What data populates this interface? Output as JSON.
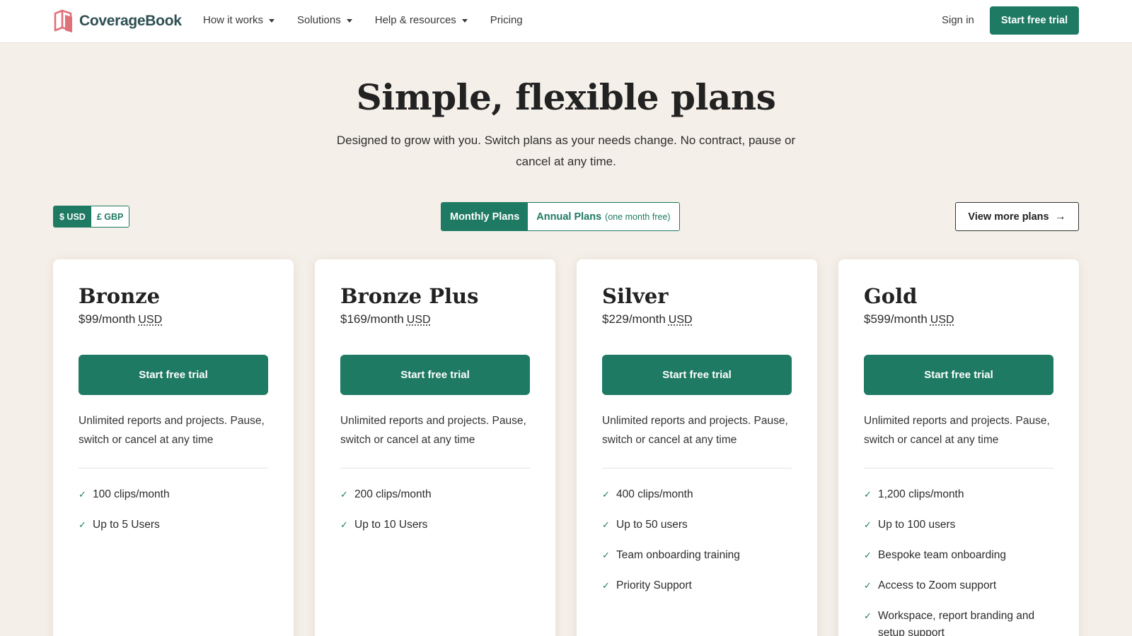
{
  "nav": {
    "logo_text": "CoverageBook",
    "links": [
      "How it works",
      "Solutions",
      "Help & resources",
      "Pricing"
    ],
    "sign_in": "Sign in",
    "cta": "Start free trial"
  },
  "hero": {
    "title": "Simple, flexible plans",
    "subtitle": "Designed to grow with you. Switch plans as your needs change. No contract, pause or cancel at any time."
  },
  "currency": {
    "usd": "$ USD",
    "gbp": "£ GBP",
    "selected": "USD"
  },
  "billing": {
    "monthly": "Monthly Plans",
    "annual": "Annual Plans",
    "annual_note": "(one month free)",
    "selected": "monthly"
  },
  "more_plans": "View more plans",
  "plans": [
    {
      "name": "Bronze",
      "price": "$99/month",
      "currency": "USD",
      "cta": "Start free trial",
      "description": "Unlimited reports and projects. Pause, switch or cancel at any time",
      "features": [
        "100 clips/month",
        "Up to 5 Users"
      ]
    },
    {
      "name": "Bronze Plus",
      "price": "$169/month",
      "currency": "USD",
      "cta": "Start free trial",
      "description": "Unlimited reports and projects. Pause, switch or cancel at any time",
      "features": [
        "200 clips/month",
        "Up to 10 Users"
      ]
    },
    {
      "name": "Silver",
      "price": "$229/month",
      "currency": "USD",
      "cta": "Start free trial",
      "description": "Unlimited reports and projects. Pause, switch or cancel at any time",
      "features": [
        "400 clips/month",
        "Up to 50 users",
        "Team onboarding training",
        "Priority Support"
      ]
    },
    {
      "name": "Gold",
      "price": "$599/month",
      "currency": "USD",
      "cta": "Start free trial",
      "description": "Unlimited reports and projects. Pause, switch or cancel at any time",
      "features": [
        "1,200 clips/month",
        "Up to 100 users",
        "Bespoke team onboarding",
        "Access to Zoom support",
        "Workspace, report branding and setup support"
      ]
    }
  ],
  "colors": {
    "brand_green": "#1f7a63",
    "background": "#f4efe8",
    "logo_pink": "#e0707a"
  }
}
